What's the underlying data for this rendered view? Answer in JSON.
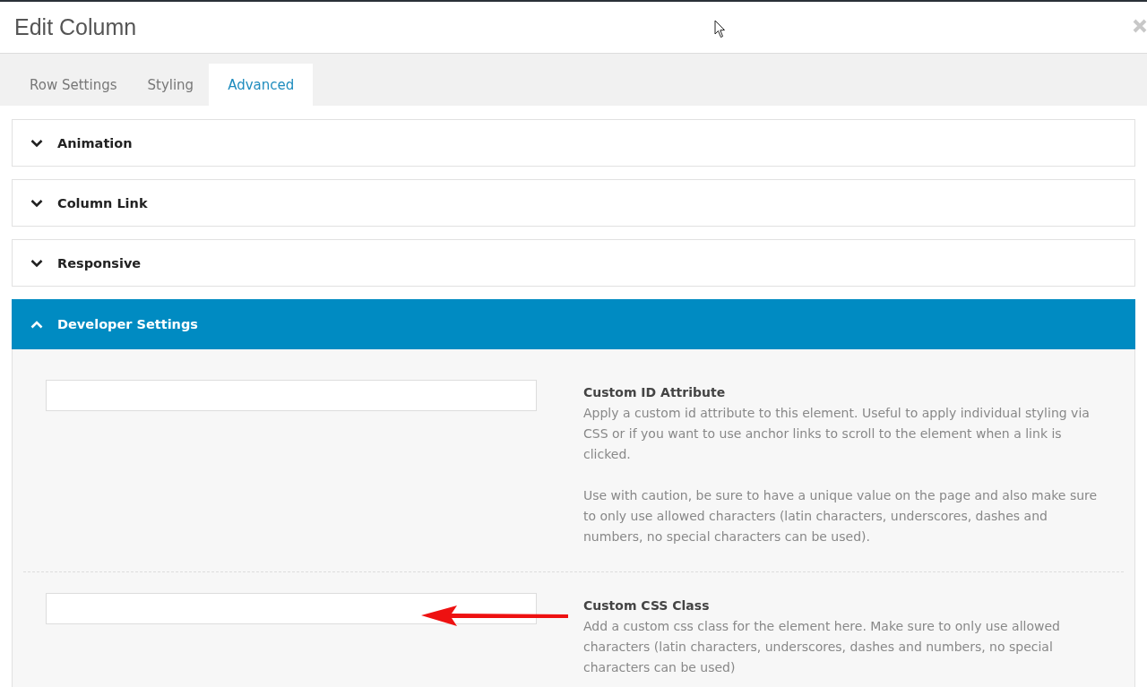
{
  "window": {
    "title": "Edit Column"
  },
  "tabs": [
    {
      "label": "Row Settings",
      "selected": false
    },
    {
      "label": "Styling",
      "selected": false
    },
    {
      "label": "Advanced",
      "selected": true
    }
  ],
  "panels": [
    {
      "title": "Animation",
      "expanded": false
    },
    {
      "title": "Column Link",
      "expanded": false
    },
    {
      "title": "Responsive",
      "expanded": false
    },
    {
      "title": "Developer Settings",
      "expanded": true,
      "settings": [
        {
          "label": "Custom ID Attribute",
          "description": [
            "Apply a custom id attribute to this element. Useful to apply individual styling via CSS or if you want to use anchor links to scroll to the element when a link is clicked.",
            "Use with caution, be sure to have a unique value on the page and also make sure to only use allowed characters (latin characters, underscores, dashes and numbers, no special characters can be used)."
          ]
        },
        {
          "label": "Custom CSS Class",
          "description": [
            "Add a custom css class for the element here. Make sure to only use allowed characters (latin characters, underscores, dashes and numbers, no special characters can be used)"
          ]
        }
      ]
    }
  ]
}
